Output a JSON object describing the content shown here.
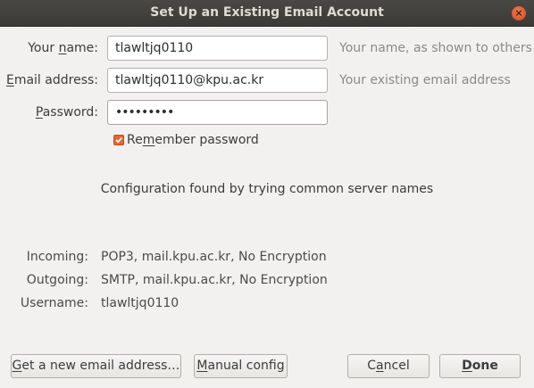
{
  "window": {
    "title": "Set Up an Existing Email Account",
    "close_glyph": "×"
  },
  "form": {
    "name": {
      "label": "Your name:",
      "value": "tlawltjq0110",
      "hint": "Your name, as shown to others"
    },
    "email": {
      "label": "Email address:",
      "value": "tlawltjq0110@kpu.ac.kr",
      "hint": "Your existing email address"
    },
    "password": {
      "label": "Password:",
      "value": "•••••••••"
    },
    "remember": {
      "label": "Remember password",
      "checked": true
    }
  },
  "status": "Configuration found by trying common server names",
  "config": {
    "incoming": {
      "label": "Incoming:",
      "value": "POP3, mail.kpu.ac.kr, No Encryption"
    },
    "outgoing": {
      "label": "Outgoing:",
      "value": "SMTP, mail.kpu.ac.kr, No Encryption"
    },
    "username": {
      "label": "Username:",
      "value": "tlawltjq0110"
    }
  },
  "buttons": {
    "new_address": "Get a new email address…",
    "manual": "Manual config",
    "cancel": "Cancel",
    "done": "Done"
  },
  "colors": {
    "accent": "#e9632c",
    "titlebar": "#3c3b37"
  }
}
